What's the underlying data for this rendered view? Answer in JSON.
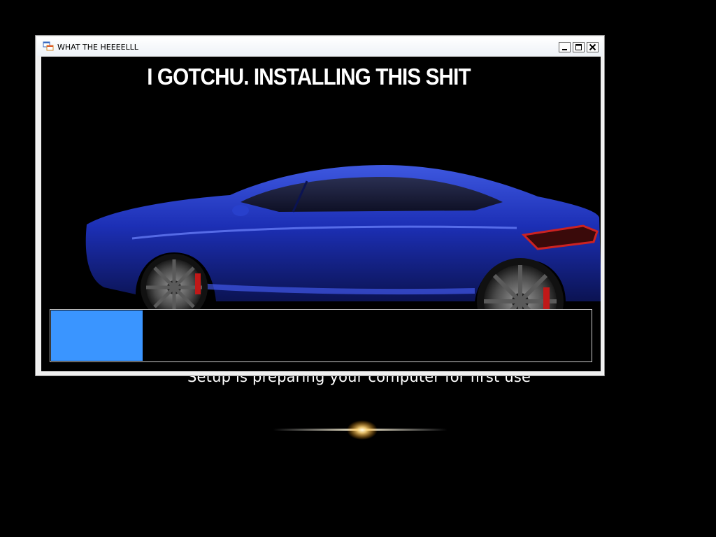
{
  "background": {
    "setup_message": "Setup is preparing your computer for first use"
  },
  "window": {
    "title": "WHAT THE HEEEELLL",
    "icon": "app-window-icon",
    "controls": [
      "minimize-icon",
      "maximize-icon",
      "close-icon"
    ]
  },
  "content": {
    "headline": "I GOTCHU. INSTALLING THIS SHIT",
    "image": "blue-sports-car"
  },
  "progress": {
    "fraction": 0.17,
    "fill_color": "#3a95ff"
  },
  "colors": {
    "desktop": "#000000",
    "window_frame": "#f0f0f0",
    "client_bg": "#000000"
  }
}
